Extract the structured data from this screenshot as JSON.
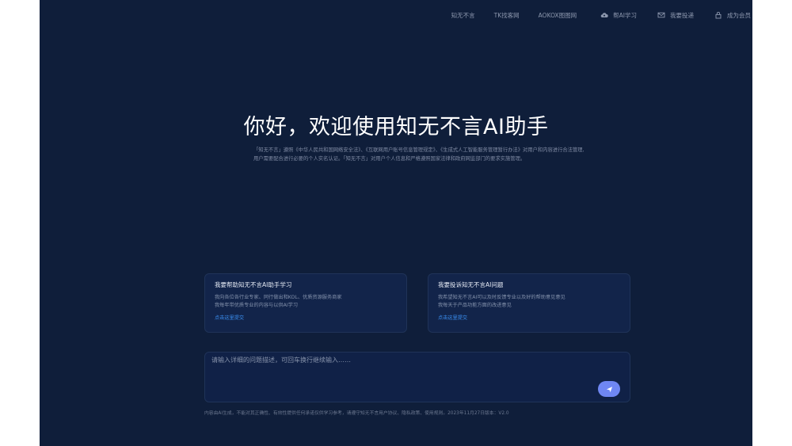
{
  "topnav": {
    "items": [
      {
        "label": "知无不言",
        "icon": ""
      },
      {
        "label": "TK找客网",
        "icon": ""
      },
      {
        "label": "AOKOX图图网",
        "icon": ""
      },
      {
        "label": "帮AI学习",
        "icon": "cloud-upload-icon"
      },
      {
        "label": "我要投递",
        "icon": "mail-icon"
      },
      {
        "label": "成为会员",
        "icon": "lock-icon"
      }
    ]
  },
  "hero": {
    "title": "你好，欢迎使用知无不言AI助手",
    "description": "「知无不言」遵照《中华人民共和国网络安全法》、《互联网用户账号信息管理规定》、《生成式人工智能服务管理暂行办法》对用户和内容进行合法管理,用户需要配合进行必要的个人实名认证。「知无不言」对用户个人信息和严格遵照国家法律和政府网监部门的要求实施管理。"
  },
  "cards": [
    {
      "title": "我要帮助知无不言AI助手学习",
      "lines": [
        "我向各位各行业专家、同行做出和KOL、优质资源服务商家",
        "我每年带优质专业的内容与以供AI学习"
      ],
      "link": "点击这里提交"
    },
    {
      "title": "我要投诉知无不言AI问题",
      "lines": [
        "我希望知无不言AI可以及时反馈专业以及好的帮助意见意见",
        "我每天于产品功能方面的改进意见"
      ],
      "link": "点击这里提交"
    }
  ],
  "composer": {
    "placeholder": "请输入详细的问题描述，可回车换行继续输入……",
    "value": ""
  },
  "disclaimer": "内容由AI生成，不能对其正确性、有效性提供任何承诺仅供学习参考，请遵守知无不言用户协议、隐私政策、使用规则。2023年11月27日版本：V2.0",
  "colors": {
    "background": "#0f1e3a",
    "accent": "#3a8ef0",
    "send_button": "#6f87f3"
  }
}
